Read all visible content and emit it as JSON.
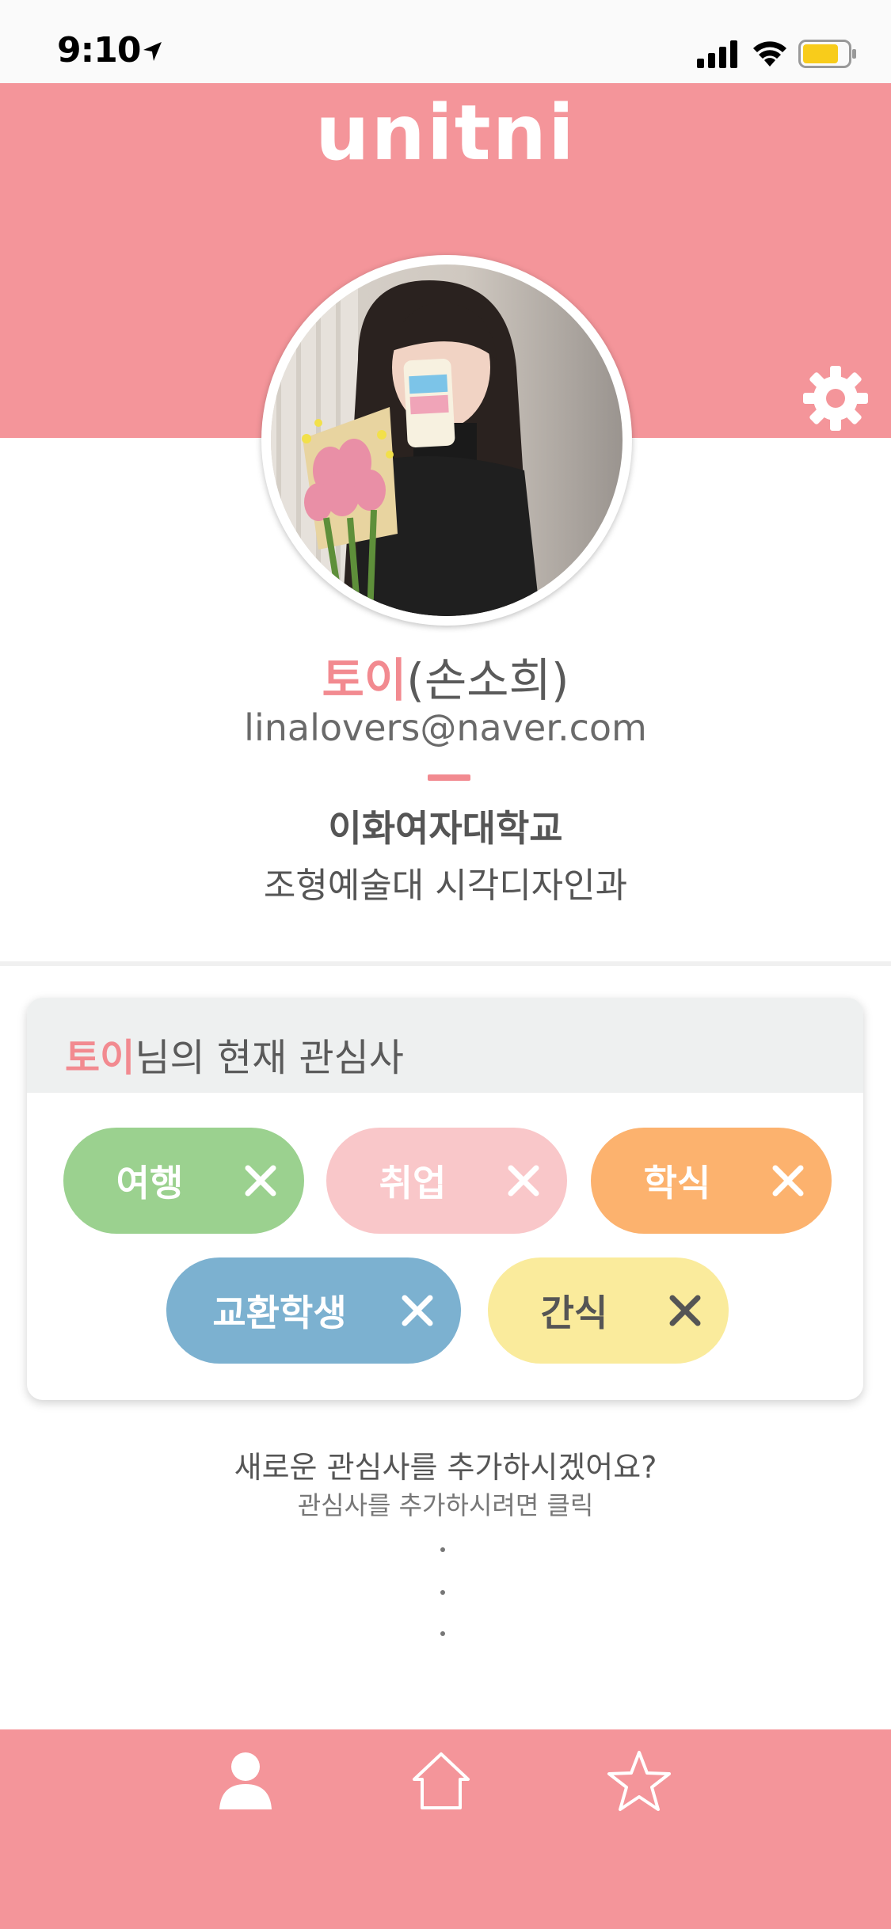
{
  "status_bar": {
    "time": "9:10"
  },
  "header": {
    "logo": "unitni"
  },
  "profile": {
    "nickname": "토이",
    "real_name": "(손소희)",
    "email": "linalovers@naver.com",
    "school": "이화여자대학교",
    "major": "조형예술대 시각디자인과"
  },
  "interests": {
    "title_nick": "토이",
    "title_rest": "님의 현재 관심사",
    "items": [
      {
        "label": "여행",
        "color": "#9bd18f",
        "text_color": "#ffffff"
      },
      {
        "label": "취업",
        "color": "#f9c7c9",
        "text_color": "#ffffff"
      },
      {
        "label": "학식",
        "color": "#fcb26e",
        "text_color": "#ffffff"
      },
      {
        "label": "교환학생",
        "color": "#7cb1d0",
        "text_color": "#ffffff"
      },
      {
        "label": "간식",
        "color": "#faeb9c",
        "text_color": "#555555"
      }
    ]
  },
  "add_prompt": {
    "question": "새로운 관심사를 추가하시겠어요?",
    "hint": "관심사를 추가하시려면 클릭"
  },
  "colors": {
    "brand": "#f4959a",
    "accent": "#f28a90"
  },
  "icons": {
    "settings": "gear-icon",
    "nav": [
      "person-icon",
      "home-icon",
      "star-icon"
    ]
  }
}
